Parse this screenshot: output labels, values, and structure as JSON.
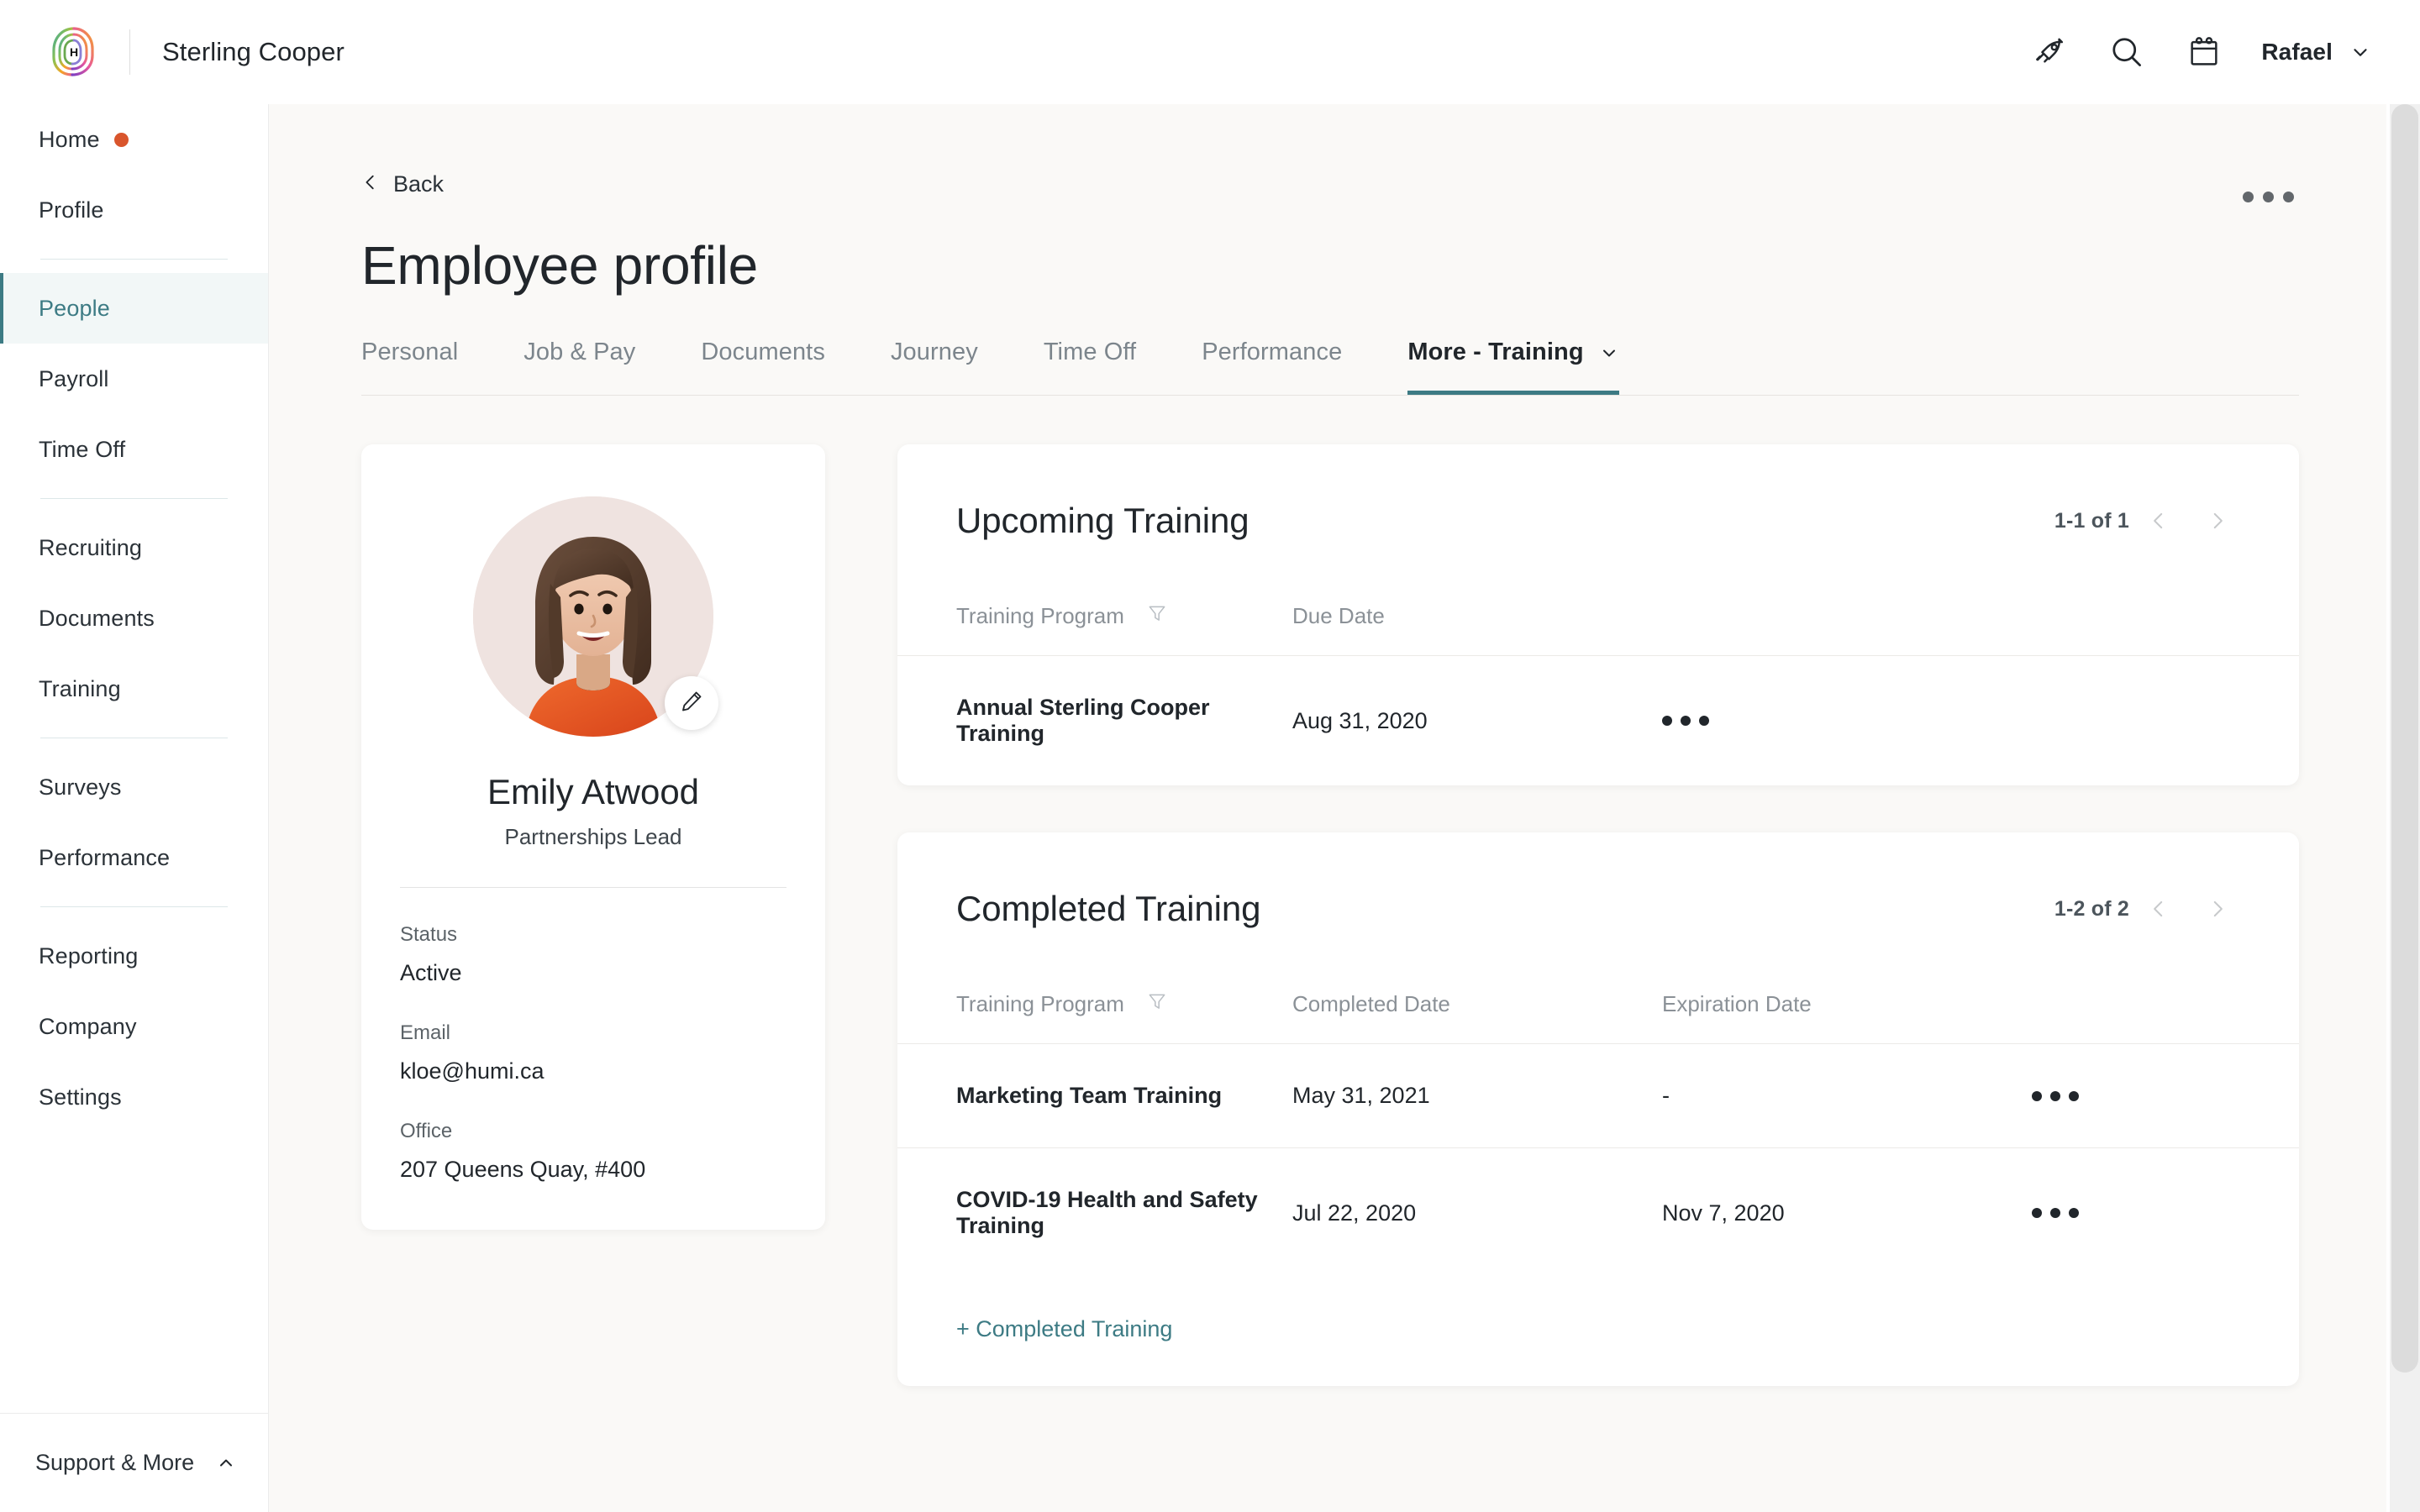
{
  "topbar": {
    "brand_name": "Sterling Cooper",
    "logo_icon": "humi-spiral-logo",
    "icons": [
      {
        "name": "rocket-icon",
        "label": "Rocket"
      },
      {
        "name": "search-icon",
        "label": "Search"
      },
      {
        "name": "calendar-icon",
        "label": "Calendar"
      }
    ],
    "user_name": "Rafael",
    "user_caret_icon": "chevron-down-icon"
  },
  "sidebar": {
    "groups": [
      {
        "items": [
          {
            "label": "Home",
            "active": false,
            "dot": true
          },
          {
            "label": "Profile",
            "active": false,
            "dot": false
          }
        ]
      },
      {
        "items": [
          {
            "label": "People",
            "active": true,
            "dot": false
          },
          {
            "label": "Payroll",
            "active": false,
            "dot": false
          },
          {
            "label": "Time Off",
            "active": false,
            "dot": false
          }
        ]
      },
      {
        "items": [
          {
            "label": "Recruiting",
            "active": false,
            "dot": false
          },
          {
            "label": "Documents",
            "active": false,
            "dot": false
          },
          {
            "label": "Training",
            "active": false,
            "dot": false
          }
        ]
      },
      {
        "items": [
          {
            "label": "Surveys",
            "active": false,
            "dot": false
          },
          {
            "label": "Performance",
            "active": false,
            "dot": false
          }
        ]
      },
      {
        "items": [
          {
            "label": "Reporting",
            "active": false,
            "dot": false
          },
          {
            "label": "Company",
            "active": false,
            "dot": false
          },
          {
            "label": "Settings",
            "active": false,
            "dot": false
          }
        ]
      }
    ],
    "footer_label": "Support & More",
    "footer_caret_icon": "chevron-up-icon",
    "active_color": "#3d7b84",
    "active_bg": "#f2f7f7",
    "home_dot_color": "#d9552c"
  },
  "page": {
    "back_label": "Back",
    "back_icon": "chevron-left-icon",
    "title": "Employee profile",
    "overflow_icon": "kebab-horizontal-icon"
  },
  "tabs": [
    {
      "label": "Personal",
      "active": false
    },
    {
      "label": "Job & Pay",
      "active": false
    },
    {
      "label": "Documents",
      "active": false
    },
    {
      "label": "Journey",
      "active": false
    },
    {
      "label": "Time Off",
      "active": false
    },
    {
      "label": "Performance",
      "active": false
    },
    {
      "label": "More - Training",
      "active": true,
      "caret_icon": "chevron-down-icon"
    }
  ],
  "profile": {
    "avatar_icon": "user-avatar-illustration",
    "edit_icon": "pencil-icon",
    "name": "Emily Atwood",
    "role": "Partnerships Lead",
    "fields": [
      {
        "label": "Status",
        "value": "Active"
      },
      {
        "label": "Email",
        "value": "kloe@humi.ca"
      },
      {
        "label": "Office",
        "value": "207 Queens Quay, #400"
      }
    ]
  },
  "upcoming_training": {
    "title": "Upcoming Training",
    "pager": {
      "count": "1-1 of 1",
      "prev_icon": "chevron-left-icon",
      "next_icon": "chevron-right-icon"
    },
    "columns": [
      {
        "label": "Training Program",
        "filter_icon": "filter-funnel-icon"
      },
      {
        "label": "Due Date",
        "filter_icon": null
      }
    ],
    "rows": [
      {
        "program": "Annual Sterling Cooper Training",
        "due_date": "Aug 31, 2020",
        "actions_icon": "kebab-horizontal-icon"
      }
    ]
  },
  "completed_training": {
    "title": "Completed Training",
    "pager": {
      "count": "1-2 of 2",
      "prev_icon": "chevron-left-icon",
      "next_icon": "chevron-right-icon"
    },
    "columns": [
      {
        "label": "Training Program",
        "filter_icon": "filter-funnel-icon"
      },
      {
        "label": "Completed Date",
        "filter_icon": null
      },
      {
        "label": "Expiration Date",
        "filter_icon": null
      }
    ],
    "rows": [
      {
        "program": "Marketing Team Training",
        "completed_date": "May 31, 2021",
        "expiration_date": "-",
        "actions_icon": "kebab-horizontal-icon"
      },
      {
        "program": "COVID-19 Health and Safety Training",
        "completed_date": "Jul 22, 2020",
        "expiration_date": "Nov 7, 2020",
        "actions_icon": "kebab-horizontal-icon"
      }
    ],
    "add_link": "+ Completed Training"
  },
  "colors": {
    "accent_teal": "#3d7b84",
    "accent_orange": "#d9552c",
    "page_bg": "#faf9f7",
    "card_bg": "#ffffff",
    "text_primary": "#21262b",
    "text_muted": "#8b9197"
  }
}
